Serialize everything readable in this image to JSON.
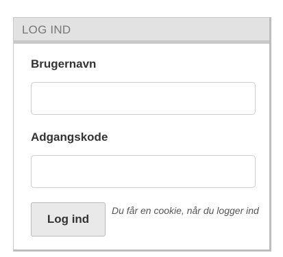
{
  "login": {
    "header": "LOG IND",
    "username_label": "Brugernavn",
    "username_value": "",
    "password_label": "Adgangskode",
    "password_value": "",
    "submit_label": "Log ind",
    "cookie_note": "Du får en cookie, når du logger ind"
  },
  "colors": {
    "header_bg": "#e2e2e2",
    "header_text": "#777777",
    "button_bg": "#e9e9e9"
  }
}
